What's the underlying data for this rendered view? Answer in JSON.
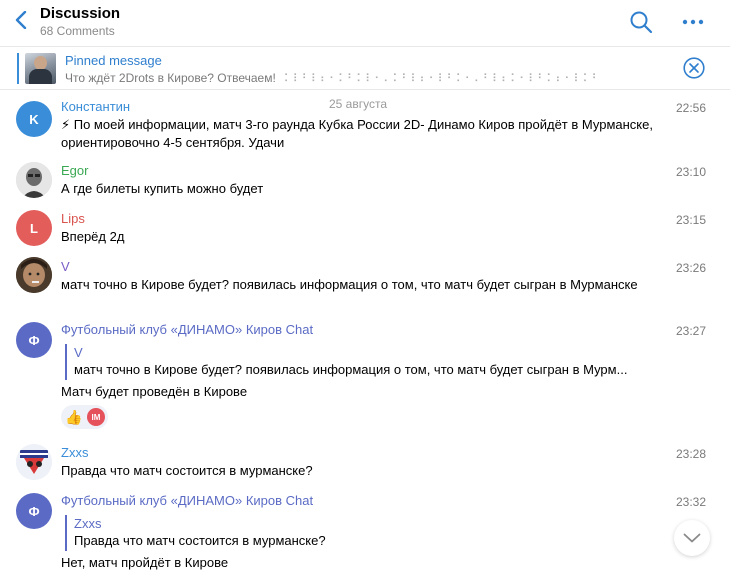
{
  "header": {
    "title": "Discussion",
    "subtitle": "68 Comments",
    "back_icon": "chevron-left-icon",
    "search_icon": "search-icon",
    "more_icon": "more-horizontal-icon"
  },
  "pinned": {
    "label": "Pinned message",
    "text": "Что ждёт 2Drots в Кирове? Отвечаем!",
    "hidden_text": "⠅⠇⠃⠇⠆⠂⠅⠃⠅⠇⠂⠄⠅⠃⠇⠆⠂⠇⠃⠅⠂⠄⠃⠇⠆⠅⠂⠇⠃⠅⠆⠂⠇⠅⠃",
    "close_icon": "close-circle-icon"
  },
  "date_separator": "25 августа",
  "colors": {
    "accent": "#2f7fce",
    "konstantin": "#3a8dd8",
    "egor": "#3aa853",
    "lips": "#d9534f",
    "v": "#7b5cc7",
    "club": "#5b6bc5",
    "zxxs": "#3a8dd8"
  },
  "messages": [
    {
      "author": "Константин",
      "avatar_initial": "K",
      "time": "22:56",
      "text": "⚡ По моей информации, матч 3-го раунда Кубка России 2D- Динамо Киров пройдёт в Мурманске, ориентировочно 4-5 сентября. Удачи"
    },
    {
      "author": "Egor",
      "avatar_initial": "",
      "time": "23:10",
      "text": "А где билеты купить можно будет"
    },
    {
      "author": "Lips",
      "avatar_initial": "L",
      "time": "23:15",
      "text": "Вперёд 2д"
    },
    {
      "author": "V",
      "avatar_initial": "",
      "time": "23:26",
      "text": "матч точно в Кирове будет? появилась информация о том, что матч будет сыгран в Мурманске"
    },
    {
      "author": "Футбольный клуб «ДИНАМО» Киров Chat",
      "avatar_initial": "Ф",
      "time": "23:27",
      "reply_author": "V",
      "reply_text": "матч точно в Кирове будет? появилась информация о том, что матч будет сыгран в Мурм...",
      "text": "Матч будет проведён в Кирове",
      "reaction_emoji": "👍",
      "reaction_badge": "IM"
    },
    {
      "author": "Zxxs",
      "avatar_initial": "",
      "time": "23:28",
      "text": "Правда что матч состоится в мурманске?"
    },
    {
      "author": "Футбольный клуб «ДИНАМО» Киров Chat",
      "avatar_initial": "Ф",
      "time": "23:32",
      "reply_author": "Zxxs",
      "reply_text": "Правда что матч состоится в мурманске?",
      "text": "Нет, матч пройдёт в Кирове"
    }
  ],
  "scroll_down_icon": "chevron-down-icon"
}
